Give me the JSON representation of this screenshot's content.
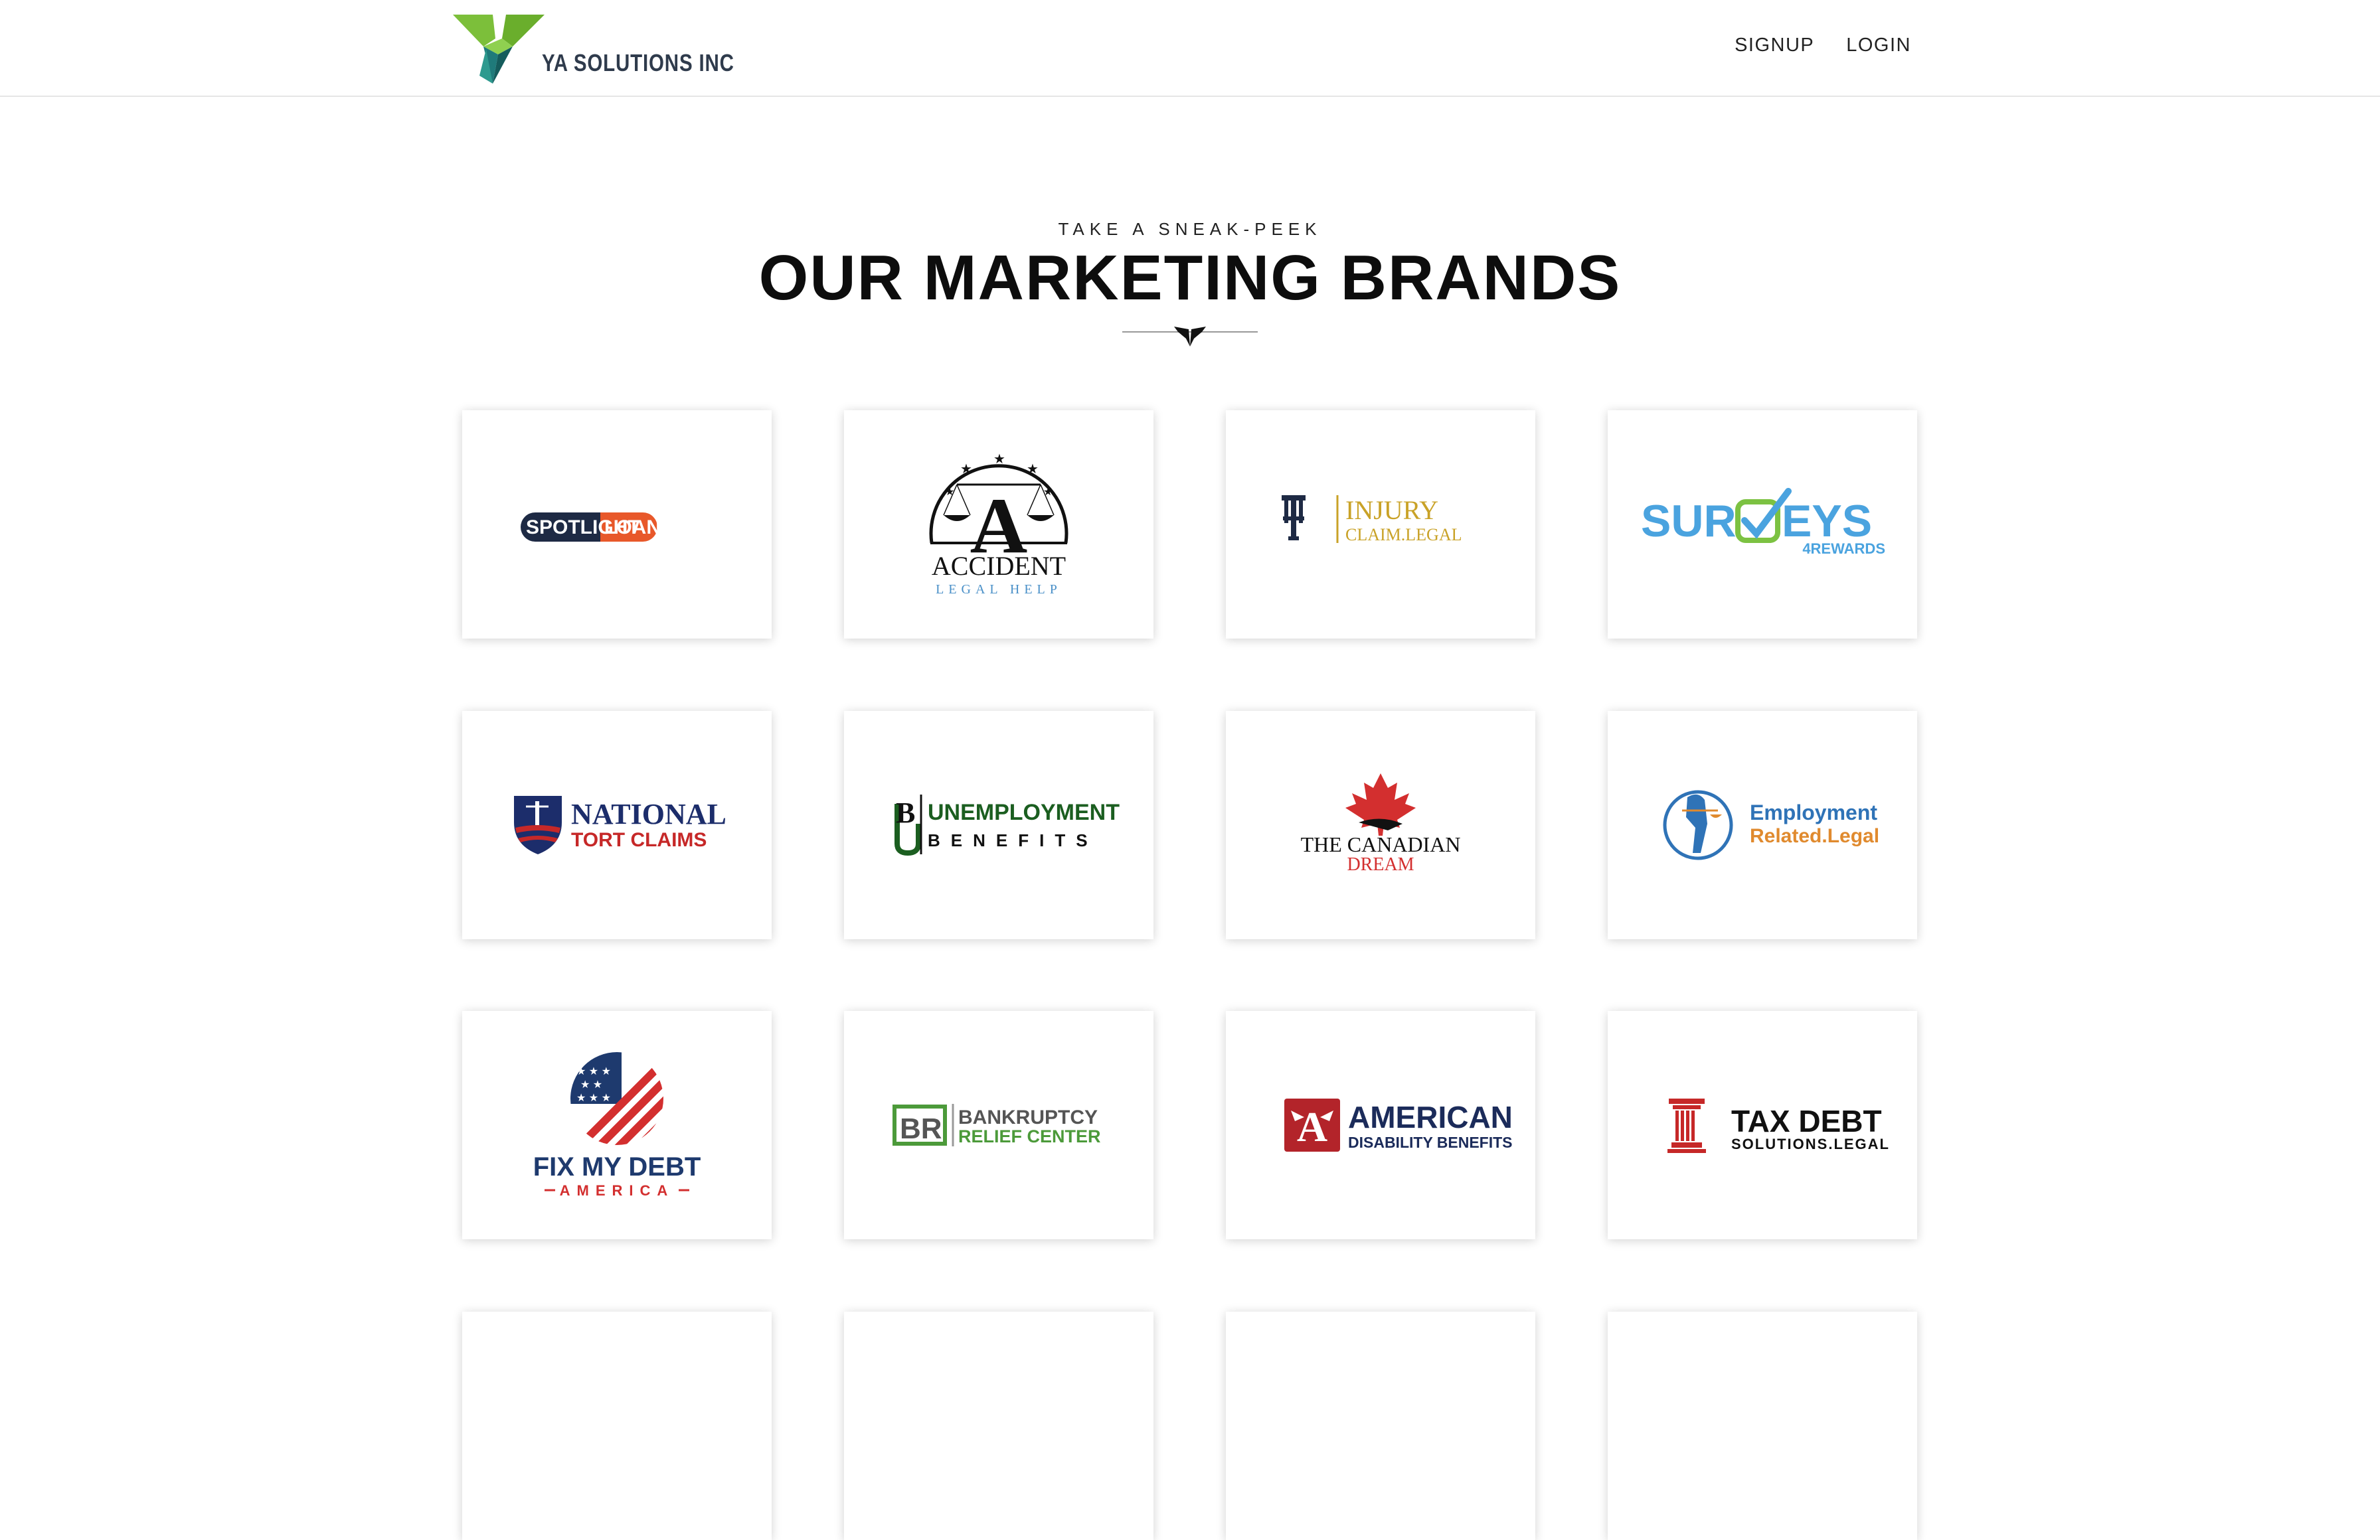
{
  "header": {
    "company_name": "YA SOLUTIONS INC",
    "nav": {
      "signup": "SIGNUP",
      "login": "LOGIN"
    }
  },
  "section": {
    "eyebrow": "TAKE A SNEAK-PEEK",
    "title": "OUR MARKETING BRANDS"
  },
  "brands": [
    {
      "name": "SPOTLIGHT LOANS",
      "logo_text": [
        "SPOTLIGHT",
        "LOANS"
      ]
    },
    {
      "name": "ACCIDENT LEGAL HELP",
      "logo_text": [
        "ACCIDENT",
        "LEGAL HELP"
      ]
    },
    {
      "name": "INJURY CLAIM.LEGAL",
      "logo_text": [
        "INJURY",
        "CLAIM.LEGAL"
      ]
    },
    {
      "name": "SURVEYS 4REWARDS",
      "logo_text": [
        "SUR",
        "EYS",
        "4REWARDS"
      ]
    },
    {
      "name": "NATIONAL TORT CLAIMS",
      "logo_text": [
        "NATIONAL",
        "TORT CLAIMS"
      ]
    },
    {
      "name": "UNEMPLOYMENT BENEFITS",
      "logo_text": [
        "UNEMPLOYMENT",
        "BENEFITS"
      ]
    },
    {
      "name": "THE CANADIAN DREAM",
      "logo_text": [
        "THE CANADIAN",
        "DREAM"
      ]
    },
    {
      "name": "Employment Related.Legal",
      "logo_text": [
        "Employment",
        "Related.Legal"
      ]
    },
    {
      "name": "FIX MY DEBT AMERICA",
      "logo_text": [
        "FIX MY DEBT",
        "AMERICA"
      ]
    },
    {
      "name": "BANKRUPTCY RELIEF CENTER",
      "logo_text": [
        "BR",
        "BANKRUPTCY",
        "RELIEF CENTER"
      ]
    },
    {
      "name": "AMERICAN DISABILITY BENEFITS",
      "logo_text": [
        "AMERICAN",
        "DISABILITY BENEFITS"
      ]
    },
    {
      "name": "TAX DEBT SOLUTIONS.LEGAL",
      "logo_text": [
        "TAX DEBT",
        "SOLUTIONS.LEGAL"
      ]
    }
  ],
  "colors": {
    "logo_green": "#7cbf3a",
    "logo_teal": "#1f7a7a",
    "spotlight_navy": "#1e2a44",
    "spotlight_orange": "#e8582a",
    "injury_gold": "#c9a227",
    "surveys_blue": "#4aa3df",
    "surveys_green": "#7cc242",
    "tort_navy": "#1c2d6b",
    "tort_red": "#c62828",
    "unemployment_green": "#1b5e20",
    "canadian_red": "#d32f2f",
    "employment_blue": "#2f73b7",
    "employment_orange": "#e08a2e",
    "fixdebt_navy": "#1e3a6e",
    "bankruptcy_green": "#4c9a3a",
    "american_red": "#b3242a",
    "american_navy": "#1b2b5a",
    "taxdebt_red": "#c62828"
  }
}
